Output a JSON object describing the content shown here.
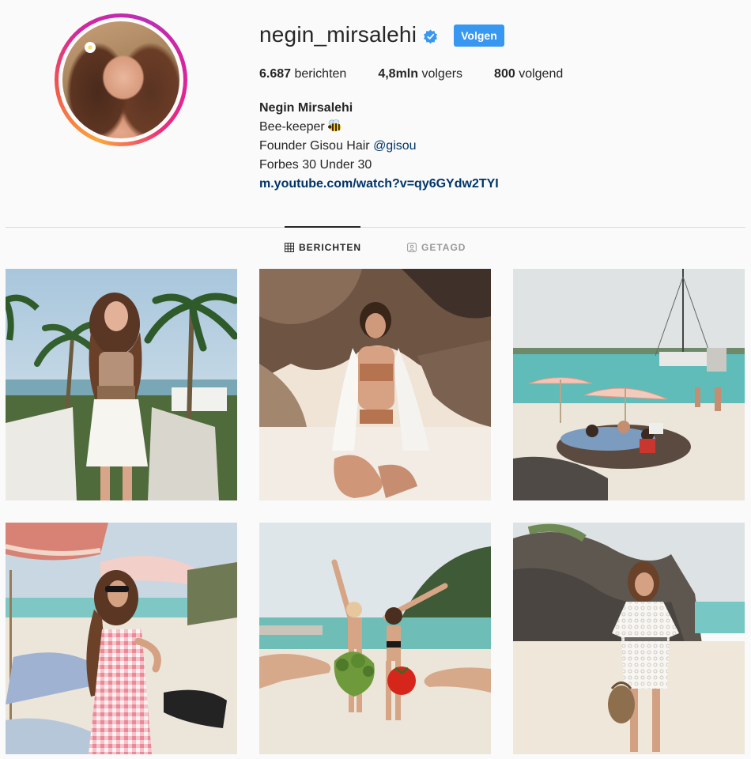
{
  "profile": {
    "username": "negin_mirsalehi",
    "verified": true,
    "follow_label": "Volgen",
    "stats": {
      "posts_count": "6.687",
      "posts_label": "berichten",
      "followers_count": "4,8mln",
      "followers_label": "volgers",
      "following_count": "800",
      "following_label": "volgend"
    },
    "bio": {
      "full_name": "Negin Mirsalehi",
      "line1": "Bee-keeper",
      "line1_emoji": "bee-emoji",
      "line2_prefix": "Founder Gisou Hair ",
      "line2_mention": "@gisou",
      "line3": "Forbes 30 Under 30",
      "link": "m.youtube.com/watch?v=qy6GYdw2TYI"
    }
  },
  "tabs": [
    {
      "label": "BERICHTEN",
      "icon": "grid-icon",
      "active": true
    },
    {
      "label": "GETAGD",
      "icon": "tagged-icon",
      "active": false
    }
  ],
  "colors": {
    "accent": "#3897f0",
    "text": "#262626",
    "link": "#003569",
    "background": "#fafafa",
    "verified": "#3897f0"
  },
  "posts": [
    {
      "subject": "woman-on-balcony-palm-trees"
    },
    {
      "subject": "woman-on-sand-by-rocks"
    },
    {
      "subject": "beach-with-umbrellas-and-catamaran"
    },
    {
      "subject": "woman-in-pink-gingham-dress-on-beach"
    },
    {
      "subject": "two-women-with-broccoli-and-tomato"
    },
    {
      "subject": "woman-in-white-lace-dress-on-beach"
    }
  ]
}
